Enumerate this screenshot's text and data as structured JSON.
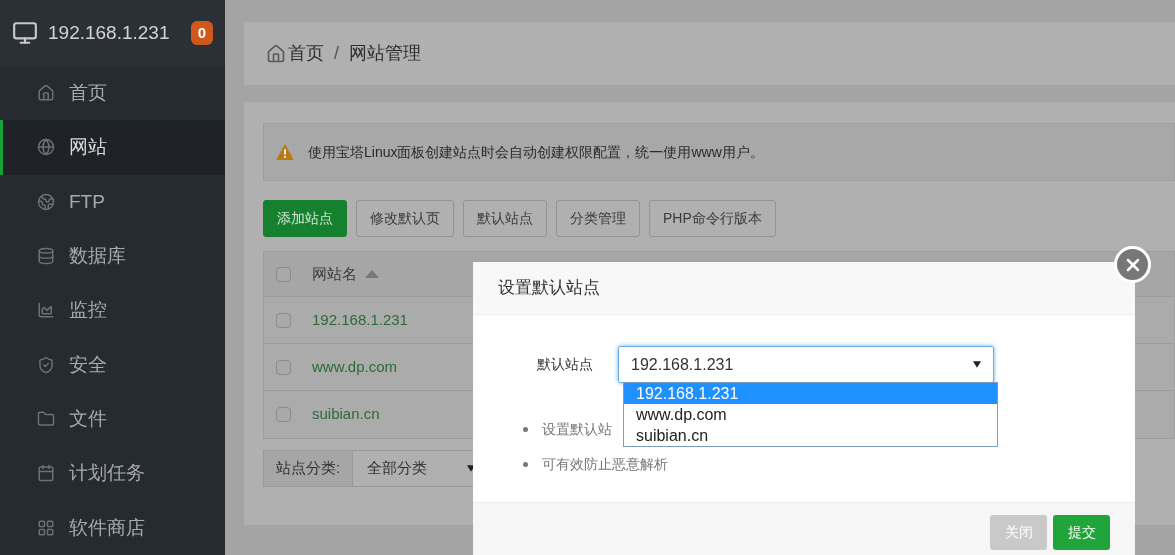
{
  "sidebar": {
    "host": "192.168.1.231",
    "badge": "0",
    "items": [
      {
        "label": "首页",
        "selected": false
      },
      {
        "label": "网站",
        "selected": true
      },
      {
        "label": "FTP",
        "selected": false
      },
      {
        "label": "数据库",
        "selected": false
      },
      {
        "label": "监控",
        "selected": false
      },
      {
        "label": "安全",
        "selected": false
      },
      {
        "label": "文件",
        "selected": false
      },
      {
        "label": "计划任务",
        "selected": false
      },
      {
        "label": "软件商店",
        "selected": false
      }
    ]
  },
  "breadcrumb": {
    "items": [
      "首页",
      "网站管理"
    ],
    "separator": "/"
  },
  "alert": {
    "text": "使用宝塔Linux面板创建站点时会自动创建权限配置，统一使用www用户。"
  },
  "toolbar": [
    {
      "label": "添加站点",
      "kind": "primary"
    },
    {
      "label": "修改默认页",
      "kind": "default"
    },
    {
      "label": "默认站点",
      "kind": "default"
    },
    {
      "label": "分类管理",
      "kind": "default"
    },
    {
      "label": "PHP命令行版本",
      "kind": "default"
    }
  ],
  "table": {
    "all_checked": false,
    "columns": [
      {
        "label": "网站名",
        "sorted": true
      }
    ],
    "rows": [
      {
        "name": "192.168.1.231",
        "checked": false
      },
      {
        "name": "www.dp.com",
        "checked": false
      },
      {
        "name": "suibian.cn",
        "checked": false
      }
    ]
  },
  "filter": {
    "label": "站点分类:",
    "value": "全部分类"
  },
  "modal": {
    "title": "设置默认站点",
    "field": {
      "label": "默认站点",
      "value": "192.168.1.231",
      "options": [
        {
          "label": "192.168.1.231",
          "selected": true
        },
        {
          "label": "www.dp.com",
          "selected": false
        },
        {
          "label": "suibian.cn",
          "selected": false
        }
      ]
    },
    "hints": [
      "设置默认站",
      "可有效防止恶意解析"
    ],
    "buttons": [
      {
        "label": "关闭",
        "kind": "secondary"
      },
      {
        "label": "提交",
        "kind": "primary"
      }
    ]
  }
}
